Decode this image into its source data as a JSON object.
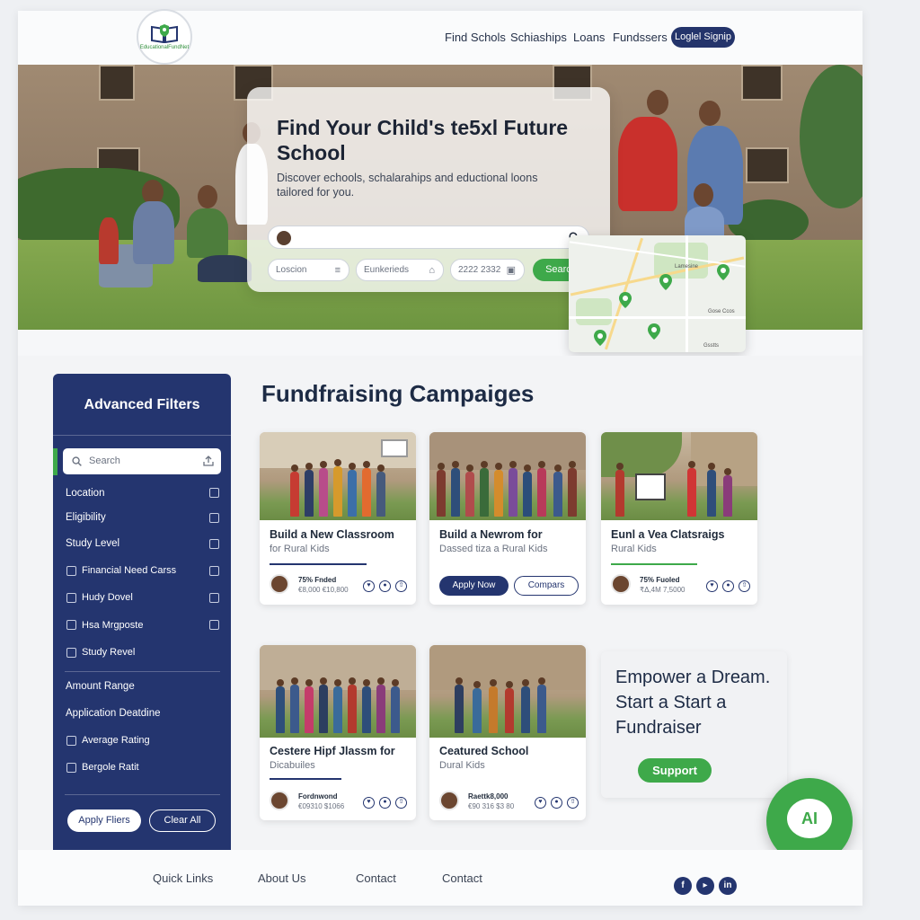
{
  "header": {
    "logo_text": "EducationalFundNet",
    "nav": [
      "Find Schols",
      "Schiaships",
      "Loans",
      "Fundssers"
    ],
    "login_label": "Loglel Signip"
  },
  "hero": {
    "title": "Find Your Child's te5xl Future School",
    "subtitle": "Discover echools, schalarahips and eductional loons tailored for you.",
    "search_placeholder": "",
    "fields": [
      {
        "placeholder": "Loscion",
        "icon": "list-icon"
      },
      {
        "placeholder": "Eunkerieds",
        "icon": "school-icon"
      },
      {
        "placeholder": "2222 2332",
        "icon": "calendar-icon"
      }
    ],
    "search_button": "Search",
    "map_labels": [
      "Lamesine",
      "Gose Ccos",
      "Gsstts"
    ]
  },
  "filters": {
    "title": "Advanced Filters",
    "search_placeholder": "Search",
    "items_top": [
      "Location",
      "Eligibility",
      "Study Level"
    ],
    "items_checks": [
      "Financial Need Carss",
      "Hudy Dovel",
      "Hsa Mrgposte",
      "Study Revel"
    ],
    "items_mid": [
      "Amount Range",
      "Application Deatdine"
    ],
    "items_bottom": [
      "Average Rating",
      "Bergole Ratit"
    ],
    "apply_label": "Apply Fliers",
    "clear_label": "Clear All"
  },
  "campaigns": {
    "heading": "Fundfraising Campaiges",
    "cards": [
      {
        "title": "Build a New Classroom",
        "subtitle": "for Rural Kids",
        "funded": "75% Fnded",
        "amount": "€8,000 €10,800"
      },
      {
        "title": "Build a Newrom for",
        "subtitle": "Dassed tiza a Rural Kids",
        "apply": "Apply Now",
        "compare": "Compars"
      },
      {
        "title": "Eunl a Vea Clatsraigs",
        "subtitle": "Rural Kids",
        "funded": "75% Fuoled",
        "amount": "₹Δ,4M 7,5000"
      },
      {
        "title": "Cestere Hipf Jlassm for",
        "subtitle": "Dicabuiles",
        "funded": "Fordnwond",
        "amount": "€09310 $1066"
      },
      {
        "title": "Ceatured School",
        "subtitle": "Dural Kids",
        "funded": "Raettk8,000",
        "amount": "€90 316 $3 80"
      }
    ]
  },
  "promo": {
    "text": "Empower a Dream. Start a Start a Fundraiser",
    "button": "Support"
  },
  "ai": {
    "label": "AI"
  },
  "footer": {
    "links": [
      "Quick Links",
      "About Us",
      "Contact",
      "Contact"
    ],
    "social": [
      "f",
      "▸",
      "in"
    ]
  },
  "colors": {
    "navy": "#24356f",
    "green": "#3ea94a"
  }
}
